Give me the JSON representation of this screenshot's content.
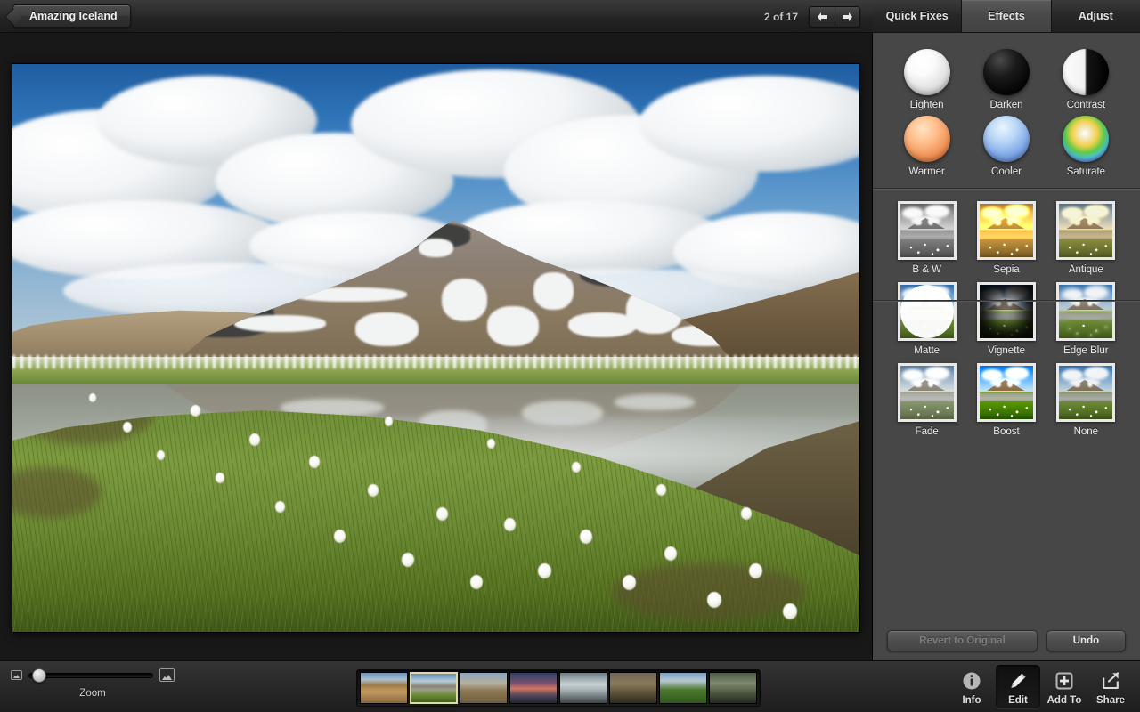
{
  "window": {
    "album_tab_label": "Amazing Iceland",
    "counter": "2 of 17",
    "prev_icon": "arrow-left-icon",
    "next_icon": "arrow-right-icon"
  },
  "panel": {
    "tabs": [
      {
        "label": "Quick Fixes",
        "active": false
      },
      {
        "label": "Effects",
        "active": true
      },
      {
        "label": "Adjust",
        "active": false
      }
    ],
    "circle_effects": [
      {
        "label": "Lighten",
        "swatch": "orb-lighten"
      },
      {
        "label": "Darken",
        "swatch": "orb-darken"
      },
      {
        "label": "Contrast",
        "swatch": "orb-contrast"
      },
      {
        "label": "Warmer",
        "swatch": "orb-warmer"
      },
      {
        "label": "Cooler",
        "swatch": "orb-cooler"
      },
      {
        "label": "Saturate",
        "swatch": "orb-saturate"
      }
    ],
    "preset_effects": [
      {
        "label": "B & W",
        "filter": "f-bw",
        "overlay": ""
      },
      {
        "label": "Sepia",
        "filter": "f-sepia",
        "overlay": ""
      },
      {
        "label": "Antique",
        "filter": "f-antique",
        "overlay": ""
      },
      {
        "label": "Matte",
        "filter": "f-none",
        "overlay": "ov-matte"
      },
      {
        "label": "Vignette",
        "filter": "f-none",
        "overlay": "ov-vign"
      },
      {
        "label": "Edge Blur",
        "filter": "f-none",
        "overlay": "ov-edge"
      },
      {
        "label": "Fade",
        "filter": "f-fade",
        "overlay": ""
      },
      {
        "label": "Boost",
        "filter": "f-boost",
        "overlay": ""
      },
      {
        "label": "None",
        "filter": "f-none",
        "overlay": ""
      }
    ],
    "revert_label": "Revert to Original",
    "undo_label": "Undo"
  },
  "bottom": {
    "zoom_label": "Zoom",
    "zoom_value_percent": 8,
    "zoom_min_icon": "small-photo-icon",
    "zoom_max_icon": "large-photo-icon",
    "filmstrip": [
      {
        "selected": false,
        "scene": "canyon"
      },
      {
        "selected": true,
        "scene": "mountain-lake"
      },
      {
        "selected": false,
        "scene": "desert-road"
      },
      {
        "selected": false,
        "scene": "sunset-coast"
      },
      {
        "selected": false,
        "scene": "geyser"
      },
      {
        "selected": false,
        "scene": "cliffs"
      },
      {
        "selected": false,
        "scene": "green-valley"
      },
      {
        "selected": false,
        "scene": "waterfall"
      }
    ],
    "tools": [
      {
        "label": "Info",
        "icon": "info-icon",
        "active": false
      },
      {
        "label": "Edit",
        "icon": "pencil-icon",
        "active": true
      },
      {
        "label": "Add To",
        "icon": "plus-square-icon",
        "active": false
      },
      {
        "label": "Share",
        "icon": "share-arrow-icon",
        "active": false
      }
    ]
  },
  "colors": {
    "panel_bg": "#474747",
    "canvas_bg": "#181818",
    "toolbar_bg": "#2a2a2a",
    "selection_border": "#ded9a8"
  }
}
